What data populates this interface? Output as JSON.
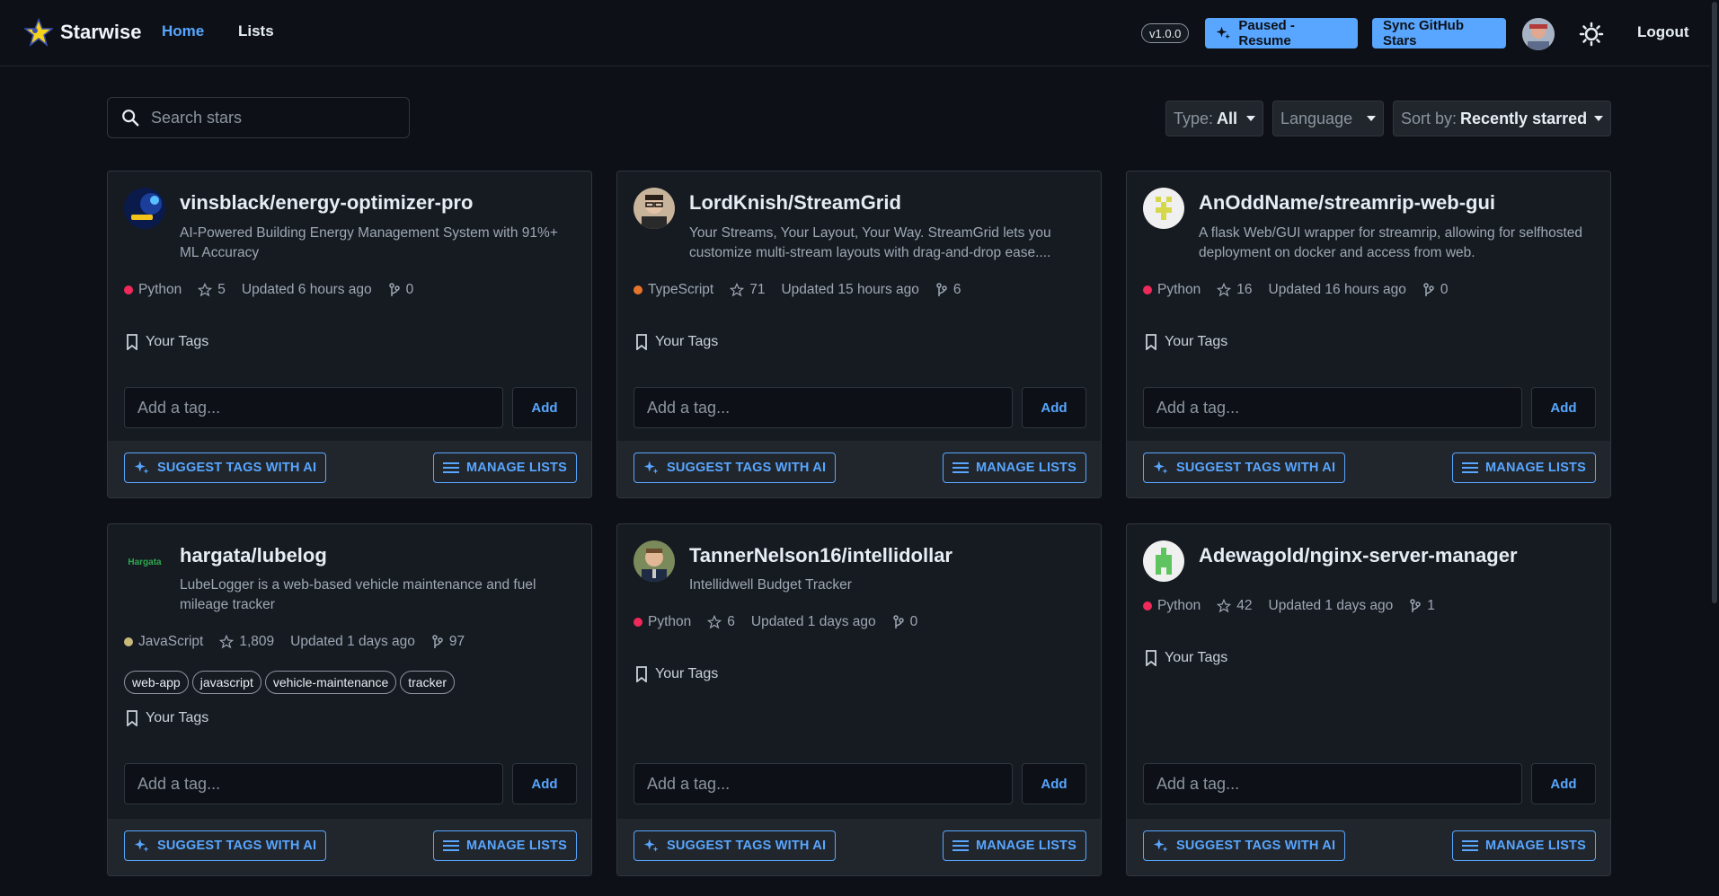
{
  "app": {
    "name": "Starwise"
  },
  "nav": {
    "home": "Home",
    "lists": "Lists"
  },
  "header": {
    "version": "v1.0.0",
    "paused_label": "Paused - Resume",
    "sync_label": "Sync GitHub Stars",
    "logout": "Logout"
  },
  "search": {
    "placeholder": "Search stars"
  },
  "filters": {
    "type_label": "Type:",
    "type_value": "All",
    "language_label": "Language",
    "sort_label": "Sort by:",
    "sort_value": "Recently starred"
  },
  "common": {
    "your_tags": "Your Tags",
    "tag_placeholder": "Add a tag...",
    "add": "Add",
    "suggest": "SUGGEST TAGS WITH AI",
    "manage": "MANAGE LISTS"
  },
  "colors": {
    "accent": "#58a6ff",
    "python": "#f1295a",
    "typescript": "#e8742b",
    "javascript": "#c8b97a"
  },
  "repos": [
    {
      "title": "vinsblack/energy-optimizer-pro",
      "desc": "AI-Powered Building Energy Management System with 91%+ ML Accuracy",
      "language": "Python",
      "stars": "5",
      "updated": "Updated 6 hours ago",
      "forks": "0",
      "icon": "python-logo-icon"
    },
    {
      "title": "LordKnish/StreamGrid",
      "desc": "Your Streams, Your Layout, Your Way. StreamGrid lets you customize multi-stream layouts with drag-and-drop ease....",
      "language": "TypeScript",
      "stars": "71",
      "updated": "Updated 15 hours ago",
      "forks": "6",
      "icon": "user-avatar-icon"
    },
    {
      "title": "AnOddName/streamrip-web-gui",
      "desc": "A flask Web/GUI wrapper for streamrip, allowing for selfhosted deployment on docker and access from web.",
      "language": "Python",
      "stars": "16",
      "updated": "Updated 16 hours ago",
      "forks": "0",
      "icon": "identicon-icon"
    },
    {
      "title": "hargata/lubelog",
      "desc": "LubeLogger is a web-based vehicle maintenance and fuel mileage tracker",
      "language": "JavaScript",
      "stars": "1,809",
      "updated": "Updated 1 days ago",
      "forks": "97",
      "icon": "hargata-logo-icon",
      "logo_text": "Hargata",
      "tags": [
        "web-app",
        "javascript",
        "vehicle-maintenance",
        "tracker"
      ]
    },
    {
      "title": "TannerNelson16/intellidollar",
      "desc": "Intellidwell Budget Tracker",
      "language": "Python",
      "stars": "6",
      "updated": "Updated 1 days ago",
      "forks": "0",
      "icon": "user-avatar-icon"
    },
    {
      "title": "Adewagold/nginx-server-manager",
      "desc": "",
      "language": "Python",
      "stars": "42",
      "updated": "Updated 1 days ago",
      "forks": "1",
      "icon": "identicon-icon"
    }
  ]
}
